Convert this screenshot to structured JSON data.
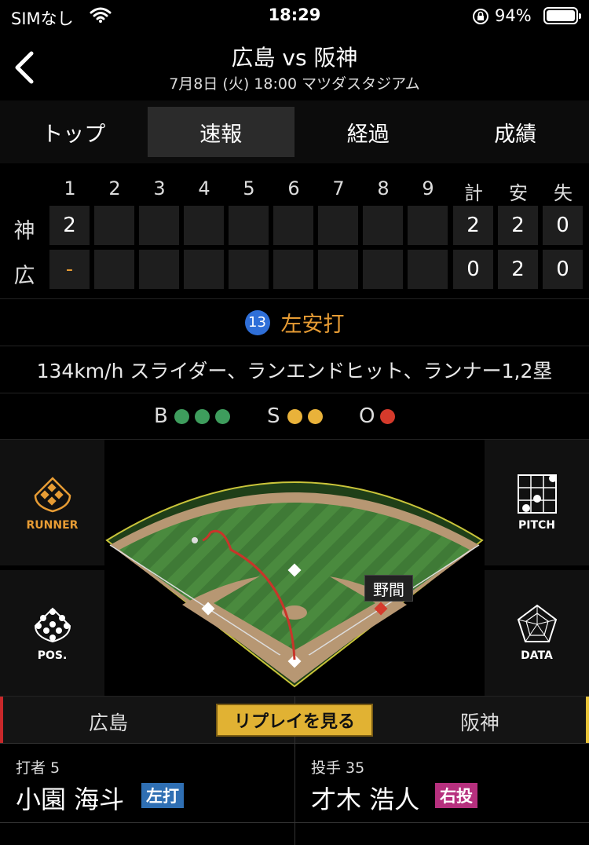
{
  "status": {
    "carrier": "SIMなし",
    "time": "18:29",
    "battery_pct": "94%"
  },
  "nav": {
    "title": "広島 vs 阪神",
    "subtitle": "7月8日 (火) 18:00 マツダスタジアム"
  },
  "tabs": [
    {
      "label": "トップ"
    },
    {
      "label": "速報"
    },
    {
      "label": "経過"
    },
    {
      "label": "成績"
    }
  ],
  "scoreboard": {
    "innings": [
      "1",
      "2",
      "3",
      "4",
      "5",
      "6",
      "7",
      "8",
      "9"
    ],
    "total_headers": [
      "計",
      "安",
      "失"
    ],
    "rows": [
      {
        "team": "神",
        "scores": [
          "2",
          "",
          "",
          "",
          "",
          "",
          "",
          "",
          ""
        ],
        "totals": [
          "2",
          "2",
          "0"
        ]
      },
      {
        "team": "広",
        "scores": [
          "-",
          "",
          "",
          "",
          "",
          "",
          "",
          "",
          ""
        ],
        "totals": [
          "0",
          "2",
          "0"
        ]
      }
    ]
  },
  "play": {
    "number": "13",
    "result": "左安打",
    "description": "134km/h スライダー、ランエンドヒット、ランナー1,2塁"
  },
  "count": {
    "b_label": "B",
    "s_label": "S",
    "o_label": "O",
    "balls": 3,
    "strikes": 2,
    "outs": 1
  },
  "field": {
    "runner_label": "RUNNER",
    "pos_label": "POS.",
    "pitch_label": "PITCH",
    "data_label": "DATA",
    "fielder_tag": "野間"
  },
  "teambar": {
    "home": "広島",
    "replay": "リプレイを見る",
    "away": "阪神"
  },
  "batter": {
    "role": "打者 5",
    "name": "小園 海斗",
    "badge": "左打"
  },
  "pitcher": {
    "role": "投手 35",
    "name": "才木 浩人",
    "badge": "右投"
  },
  "colors": {
    "accent_orange": "#e79c34",
    "replay_gold": "#e1b233",
    "ball_green": "#3e9d5d",
    "strike_yellow": "#e9b23a",
    "out_red": "#d53a2b",
    "batter_badge": "#2f6fb3",
    "pitcher_badge": "#b6307e"
  }
}
